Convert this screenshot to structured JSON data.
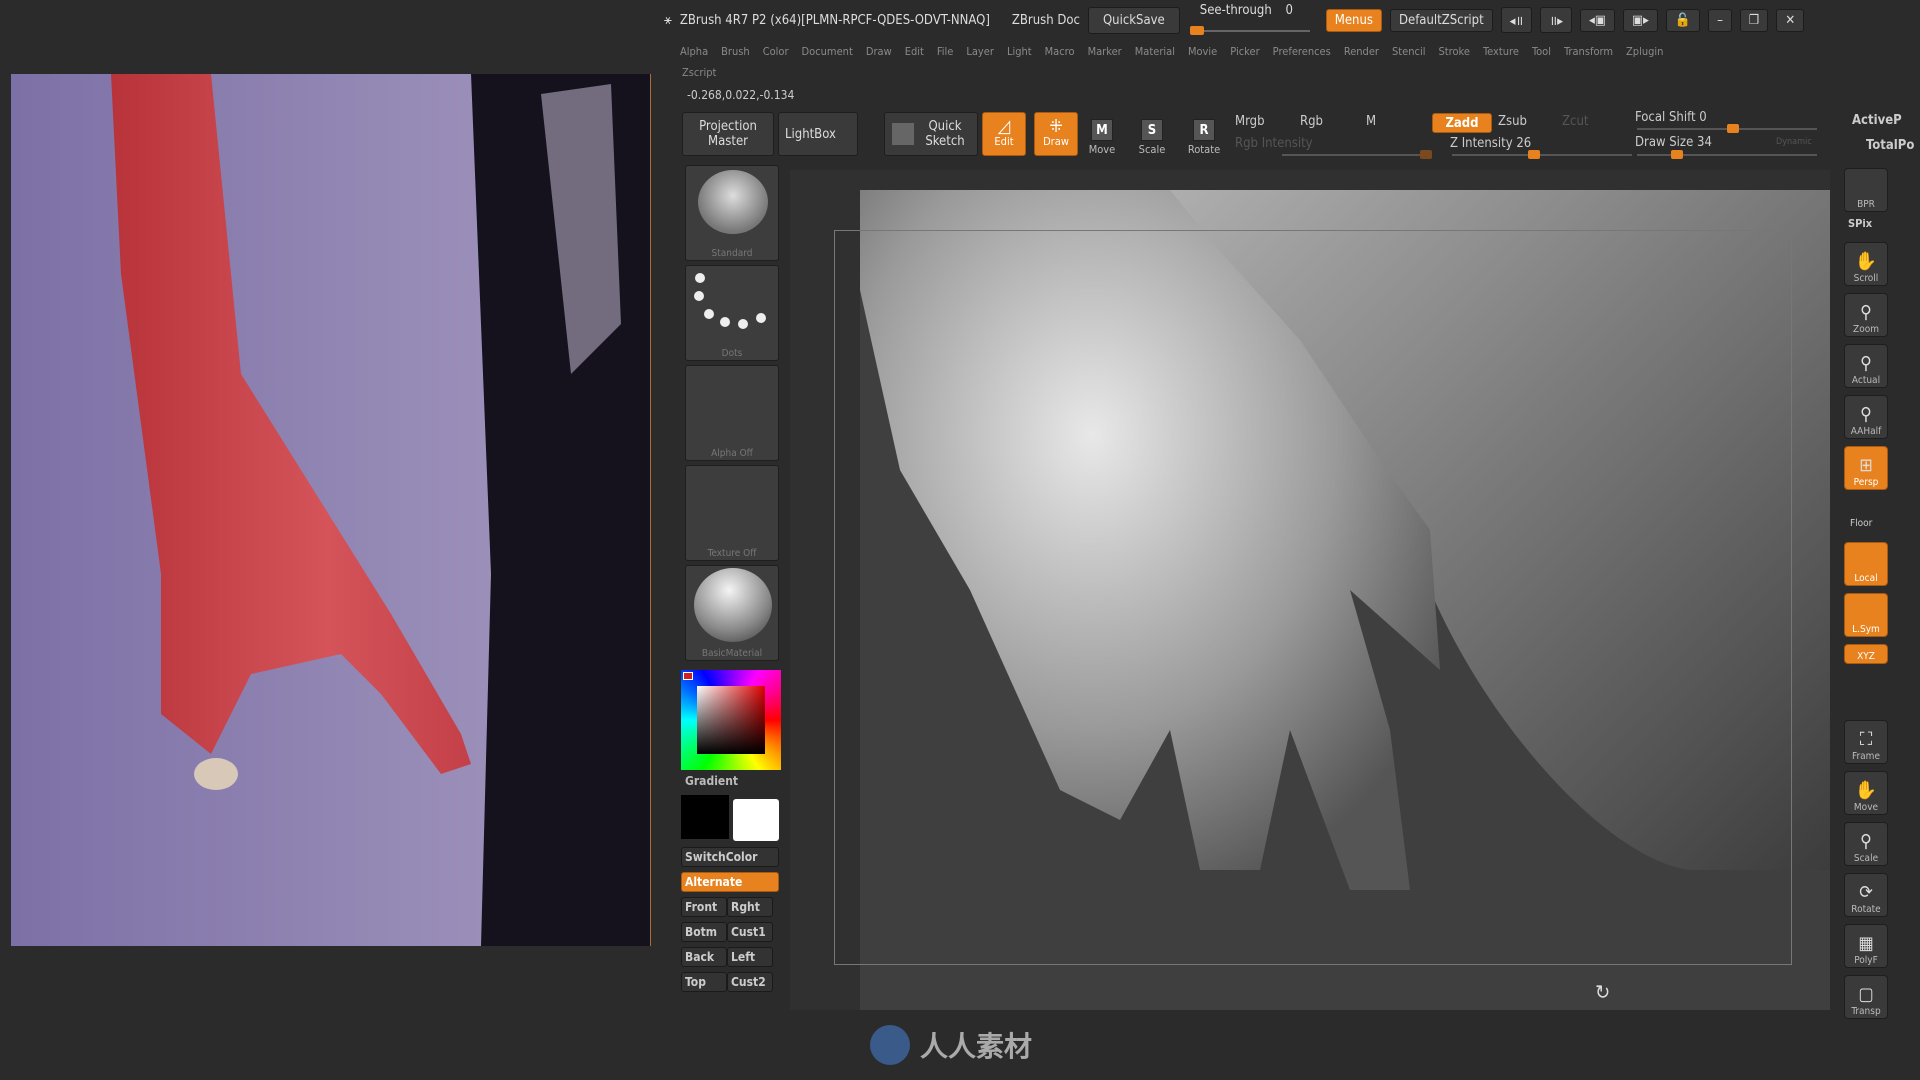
{
  "title_bar": {
    "app_title": "ZBrush 4R7 P2 (x64)[PLMN-RPCF-QDES-ODVT-NNAQ]",
    "document": "ZBrush Doc",
    "quicksave": "QuickSave",
    "see_through_label": "See-through",
    "see_through_value": "0",
    "see_through_level": 0,
    "menus": "Menus",
    "default_zscript": "DefaultZScript"
  },
  "menu": [
    "Alpha",
    "Brush",
    "Color",
    "Document",
    "Draw",
    "Edit",
    "File",
    "Layer",
    "Light",
    "Macro",
    "Marker",
    "Material",
    "Movie",
    "Picker",
    "Preferences",
    "Render",
    "Stencil",
    "Stroke",
    "Texture",
    "Tool",
    "Transform",
    "Zplugin"
  ],
  "zscript_menu": "Zscript",
  "coords_readout": "-0.268,0.022,-0.134",
  "toolbar": {
    "projection_master": "Projection Master",
    "lightbox": "LightBox",
    "quick_sketch": "Quick Sketch",
    "edit": "Edit",
    "draw": "Draw",
    "move": "Move",
    "scale": "Scale",
    "rotate": "Rotate",
    "mrgb": "Mrgb",
    "rgb": "Rgb",
    "m": "M",
    "rgb_intensity": "Rgb Intensity",
    "zadd": "Zadd",
    "zsub": "Zsub",
    "zcut": "Zcut",
    "z_intensity_label": "Z Intensity",
    "z_intensity": "26",
    "focal_shift_label": "Focal Shift",
    "focal_shift": "0",
    "draw_size_label": "Draw Size",
    "draw_size": "34",
    "dynamic": "Dynamic",
    "active_points": "ActiveP",
    "total_points": "TotalPo"
  },
  "left_shelf": {
    "brush": "Standard",
    "stroke": "Dots",
    "alpha": "Alpha Off",
    "texture": "Texture Off",
    "material": "BasicMaterial",
    "gradient": "Gradient",
    "switch_color": "SwitchColor",
    "alternate": "Alternate",
    "views": [
      "Front",
      "Rght",
      "Botm",
      "Cust1",
      "Back",
      "Left",
      "Top",
      "Cust2"
    ]
  },
  "right_shelf": {
    "bpr": "BPR",
    "spix": "SPix",
    "buttons": [
      {
        "label": "Scroll",
        "icon": "hand-icon"
      },
      {
        "label": "Zoom",
        "icon": "magnifier-icon"
      },
      {
        "label": "Actual",
        "icon": "magnifier-icon"
      },
      {
        "label": "AAHalf",
        "icon": "magnifier-icon"
      },
      {
        "label": "Persp",
        "icon": "perspective-icon",
        "active": true
      }
    ],
    "floor": "Floor",
    "local": "Local",
    "lsym": "L.Sym",
    "xyz": "XYZ",
    "lower": [
      {
        "label": "Frame",
        "icon": "frame-icon"
      },
      {
        "label": "Move",
        "icon": "hand-icon"
      },
      {
        "label": "Scale",
        "icon": "magnifier-icon"
      },
      {
        "label": "Rotate",
        "icon": "rotate-icon"
      },
      {
        "label": "PolyF",
        "icon": "grid-icon"
      },
      {
        "label": "Transp",
        "icon": "transparency-icon"
      }
    ]
  },
  "accent_color": "#e8821e",
  "bottom_logo": "人人素材"
}
